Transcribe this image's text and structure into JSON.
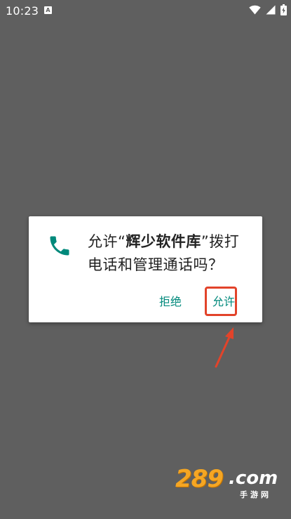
{
  "status_bar": {
    "time": "10:23",
    "notification_letter": "A"
  },
  "dialog": {
    "message_prefix": "允许“",
    "app_name": "辉少软件库",
    "message_suffix": "”拨打电话和管理通话吗？",
    "deny_label": "拒绝",
    "allow_label": "允许",
    "accent_color": "#00897b",
    "icon": "phone-icon"
  },
  "annotation": {
    "highlight_color": "#e2432a"
  },
  "watermark": {
    "number": "289",
    "domain": ".com",
    "subtitle": "手游网"
  }
}
